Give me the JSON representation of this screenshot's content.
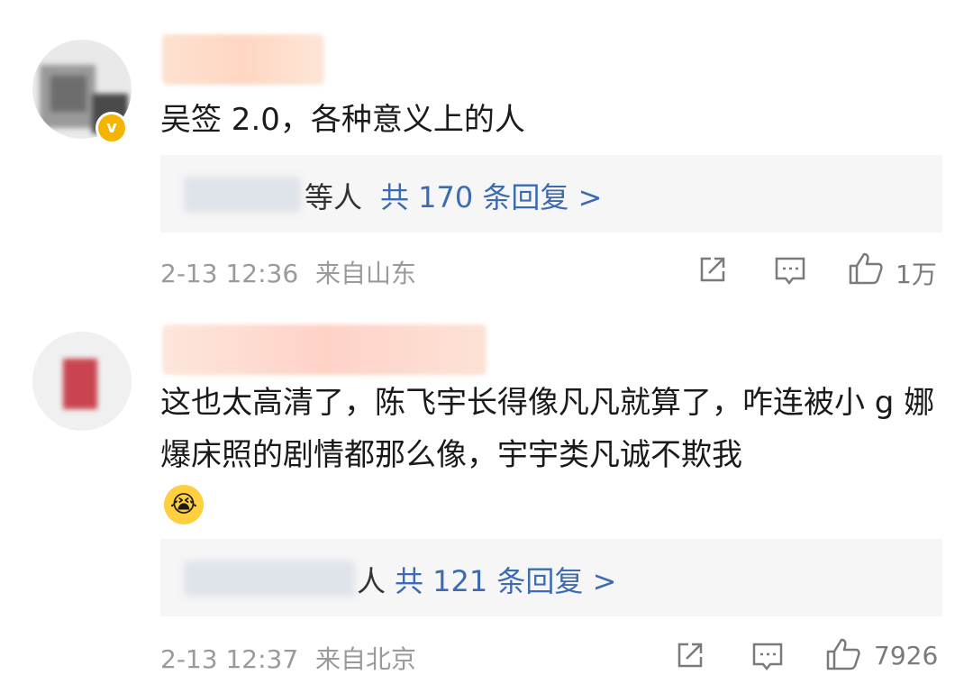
{
  "comments": [
    {
      "text": "吴签 2.0，各种意义上的人",
      "reply_suffix": "等人",
      "reply_link": "共 170 条回复 >",
      "time": "2-13 12:36",
      "location": "来自山东",
      "likes": "1万",
      "verified": true,
      "emoji": ""
    },
    {
      "text": "这也太高清了，陈飞宇长得像凡凡就算了，咋连被小 g 娜爆床照的剧情都那么像，宇宇类凡诚不欺我",
      "reply_suffix": "人",
      "reply_link": "共 121 条回复 >",
      "time": "2-13 12:37",
      "location": "来自北京",
      "likes": "7926",
      "verified": false,
      "emoji": "😭"
    }
  ],
  "icons": {
    "share": "share-icon",
    "comment": "comment-icon",
    "like": "thumbs-up-icon"
  },
  "colors": {
    "link": "#3d6bb0",
    "meta": "#9a9a9a",
    "reply_bg": "#f6f6f6",
    "verified_badge": "#f4b400"
  }
}
